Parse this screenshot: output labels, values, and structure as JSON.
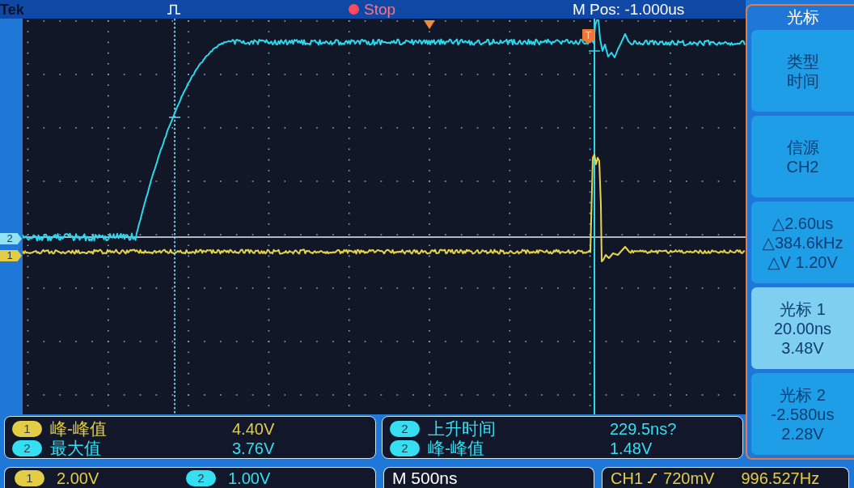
{
  "top_bar": {
    "brand": "Tek",
    "acquisition": {
      "state": "Stop",
      "running": false
    },
    "position": "M Pos: -1.000us"
  },
  "channel_markers": [
    {
      "label": "2",
      "color": "#8fe3f2"
    },
    {
      "label": "1",
      "color": "#e3cd47"
    }
  ],
  "trigger_marker": "T",
  "menu": {
    "title": "光标",
    "items": [
      {
        "lines": [
          "类型",
          "时间"
        ],
        "selected": false
      },
      {
        "lines": [
          "信源",
          "CH2"
        ],
        "selected": false
      },
      {
        "lines": [
          "△2.60us",
          "△384.6kHz",
          "△V 1.20V"
        ],
        "selected": false
      },
      {
        "lines": [
          "光标 1",
          "20.00ns",
          "3.48V"
        ],
        "selected": true
      },
      {
        "lines": [
          "光标 2",
          "-2.580us",
          "2.28V"
        ],
        "selected": false
      }
    ]
  },
  "measurement_panels": [
    {
      "rows": [
        {
          "channel": "1",
          "color": "#e3cd47",
          "label": "峰-峰值",
          "value": "4.40V"
        },
        {
          "channel": "2",
          "color": "#36def2",
          "label": "最大值",
          "value": "3.76V"
        }
      ]
    },
    {
      "rows": [
        {
          "channel": "2",
          "color": "#36def2",
          "label": "上升时间",
          "value": "229.5ns?"
        },
        {
          "channel": "2",
          "color": "#36def2",
          "label": "峰-峰值",
          "value": "1.48V"
        }
      ]
    }
  ],
  "status_bar": {
    "channels": [
      {
        "channel": "1",
        "color": "#e3cd47",
        "scale": "2.00V"
      },
      {
        "channel": "2",
        "color": "#36def2",
        "scale": "1.00V"
      }
    ],
    "timebase": "M 500ns",
    "trigger": {
      "source": "CH1",
      "rising": true,
      "level": "720mV",
      "frequency": "996.527Hz"
    }
  }
}
